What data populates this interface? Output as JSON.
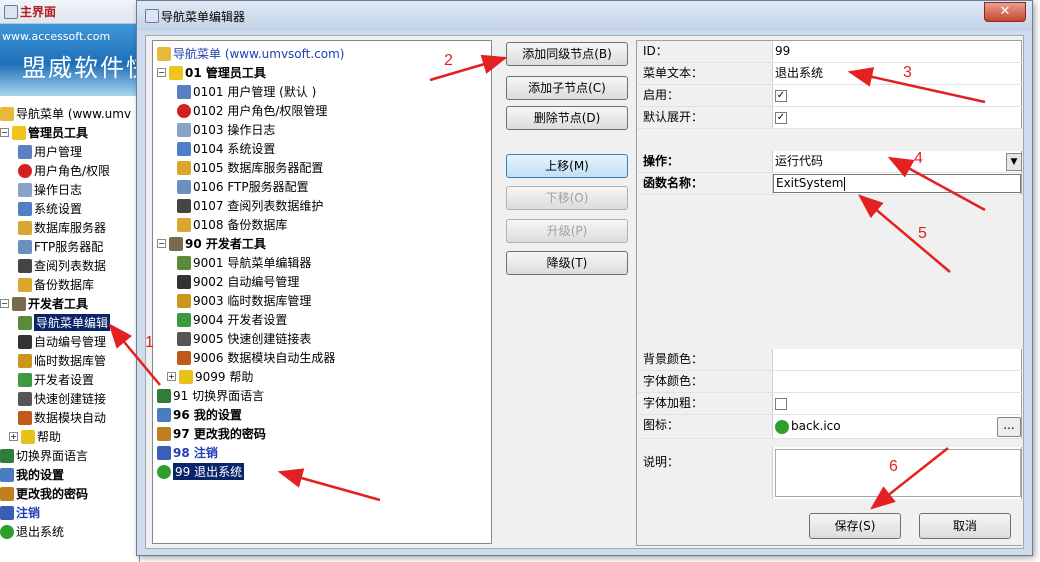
{
  "main_window": {
    "title": "主界面",
    "banner_url": "www.accessoft.com",
    "banner_brand": "盟威软件快",
    "tree": [
      {
        "label": "导航菜单 (www.umv",
        "icon": "folder-icon",
        "indent": 0,
        "expander": ""
      },
      {
        "label": "管理员工具",
        "icon": "star-icon",
        "indent": 0,
        "expander": "−",
        "bold": true
      },
      {
        "label": "用户管理",
        "icon": "users-icon",
        "indent": 2
      },
      {
        "label": "用户角色/权限",
        "icon": "no-entry-icon",
        "indent": 2
      },
      {
        "label": "操作日志",
        "icon": "document-icon",
        "indent": 2
      },
      {
        "label": "系统设置",
        "icon": "settings-doc-icon",
        "indent": 2
      },
      {
        "label": "数据库服务器",
        "icon": "database-icon",
        "indent": 2
      },
      {
        "label": "FTP服务器配",
        "icon": "server-icon",
        "indent": 2
      },
      {
        "label": "查阅列表数据",
        "icon": "list-icon",
        "indent": 2
      },
      {
        "label": "备份数据库",
        "icon": "database-icon",
        "indent": 2
      },
      {
        "label": "开发者工具",
        "icon": "tools-icon",
        "indent": 0,
        "expander": "−",
        "bold": true
      },
      {
        "label": "导航菜单编辑",
        "icon": "edit-icon",
        "indent": 2,
        "selected": true
      },
      {
        "label": "自动编号管理",
        "icon": "numbered-list-icon",
        "indent": 2
      },
      {
        "label": "临时数据库管",
        "icon": "temp-db-icon",
        "indent": 2
      },
      {
        "label": "开发者设置",
        "icon": "developer-icon",
        "indent": 2
      },
      {
        "label": "快速创建链接",
        "icon": "link-icon",
        "indent": 2
      },
      {
        "label": "数据模块自动",
        "icon": "wand-icon",
        "indent": 2
      },
      {
        "label": "帮助",
        "icon": "help-icon",
        "indent": 1,
        "expander": "+"
      },
      {
        "label": "切换界面语言",
        "icon": "language-icon",
        "indent": 0
      },
      {
        "label": "我的设置",
        "icon": "user-settings-icon",
        "indent": 0,
        "bold": true
      },
      {
        "label": "更改我的密码",
        "icon": "user-key-icon",
        "indent": 0,
        "bold": true
      },
      {
        "label": "注销",
        "icon": "logout-icon",
        "indent": 0,
        "bold": true,
        "color": "#1f3fb3"
      },
      {
        "label": "退出系统",
        "icon": "exit-icon",
        "indent": 0
      }
    ]
  },
  "dialog": {
    "title": "导航菜单编辑器",
    "close_label": "✕",
    "tree": [
      {
        "label": "导航菜单 (www.umvsoft.com)",
        "icon": "folder-icon",
        "indent": 0,
        "expander": "",
        "color": "#1f3fb3"
      },
      {
        "label": "01 管理员工具",
        "icon": "star-icon",
        "indent": 0,
        "expander": "−",
        "bold": true
      },
      {
        "label": "0101 用户管理 (默认 )",
        "icon": "users-icon",
        "indent": 2
      },
      {
        "label": "0102 用户角色/权限管理",
        "icon": "no-entry-icon",
        "indent": 2
      },
      {
        "label": "0103 操作日志",
        "icon": "document-icon",
        "indent": 2
      },
      {
        "label": "0104 系统设置",
        "icon": "settings-doc-icon",
        "indent": 2
      },
      {
        "label": "0105 数据库服务器配置",
        "icon": "database-icon",
        "indent": 2
      },
      {
        "label": "0106 FTP服务器配置",
        "icon": "server-icon",
        "indent": 2
      },
      {
        "label": "0107 查阅列表数据维护",
        "icon": "list-icon",
        "indent": 2
      },
      {
        "label": "0108 备份数据库",
        "icon": "database-icon",
        "indent": 2
      },
      {
        "label": "90 开发者工具",
        "icon": "tools-icon",
        "indent": 0,
        "expander": "−",
        "bold": true
      },
      {
        "label": "9001 导航菜单编辑器",
        "icon": "edit-icon",
        "indent": 2
      },
      {
        "label": "9002 自动编号管理",
        "icon": "numbered-list-icon",
        "indent": 2
      },
      {
        "label": "9003 临时数据库管理",
        "icon": "temp-db-icon",
        "indent": 2
      },
      {
        "label": "9004 开发者设置",
        "icon": "developer-icon",
        "indent": 2
      },
      {
        "label": "9005 快速创建链接表",
        "icon": "link-icon",
        "indent": 2
      },
      {
        "label": "9006 数据模块自动生成器",
        "icon": "wand-icon",
        "indent": 2
      },
      {
        "label": "9099 帮助",
        "icon": "help-icon",
        "indent": 1,
        "expander": "+"
      },
      {
        "label": "91 切换界面语言",
        "icon": "language-icon",
        "indent": 0
      },
      {
        "label": "96 我的设置",
        "icon": "user-settings-icon",
        "indent": 0,
        "bold": true
      },
      {
        "label": "97 更改我的密码",
        "icon": "user-key-icon",
        "indent": 0,
        "bold": true
      },
      {
        "label": "98 注销",
        "icon": "logout-icon",
        "indent": 0,
        "bold": true,
        "color": "#1f3fb3"
      },
      {
        "label": "99 退出系统",
        "icon": "exit-icon",
        "indent": 0,
        "selected": true
      }
    ],
    "buttons": {
      "add_sibling": "添加同级节点(B)",
      "add_child": "添加子节点(C)",
      "delete": "删除节点(D)",
      "move_up": "上移(M)",
      "move_down": "下移(O)",
      "promote": "升级(P)",
      "demote": "降级(T)"
    },
    "props": {
      "id_label": "ID：",
      "id_value": "99",
      "text_label": "菜单文本：",
      "text_value": "退出系统",
      "enabled_label": "启用：",
      "enabled_mark": "✓",
      "expand_label": "默认展开：",
      "expand_mark": "✓",
      "action_label": "操作：",
      "action_value": "运行代码",
      "func_label": "函数名称：",
      "func_value": "ExitSystem",
      "bgcolor_label": "背景颜色：",
      "fontcolor_label": "字体颜色：",
      "bold_label": "字体加粗：",
      "icon_label": "图标：",
      "icon_value": "back.ico",
      "browse_label": "...",
      "desc_label": "说明："
    },
    "save_button": "保存(S)",
    "cancel_button": "取消"
  },
  "annotations": [
    "1",
    "2",
    "3",
    "4",
    "5",
    "6"
  ],
  "icon_colors": {
    "folder-icon": "#e8b93a",
    "star-icon": "#f0c419",
    "users-icon": "#5a7fc4",
    "no-entry-icon": "#d42020",
    "document-icon": "#8aa2c8",
    "settings-doc-icon": "#4f7fc9",
    "database-icon": "#d9a630",
    "server-icon": "#6a8fc0",
    "list-icon": "#444444",
    "tools-icon": "#7a6a50",
    "edit-icon": "#5b8a3a",
    "numbered-list-icon": "#333333",
    "temp-db-icon": "#c9961f",
    "developer-icon": "#3e9a3e",
    "link-icon": "#555555",
    "wand-icon": "#c05a1a",
    "help-icon": "#e6c21a",
    "language-icon": "#2f7d3a",
    "user-settings-icon": "#4a7cc0",
    "user-key-icon": "#c08020",
    "logout-icon": "#3a5fb8",
    "exit-icon": "#2e9e2e"
  }
}
